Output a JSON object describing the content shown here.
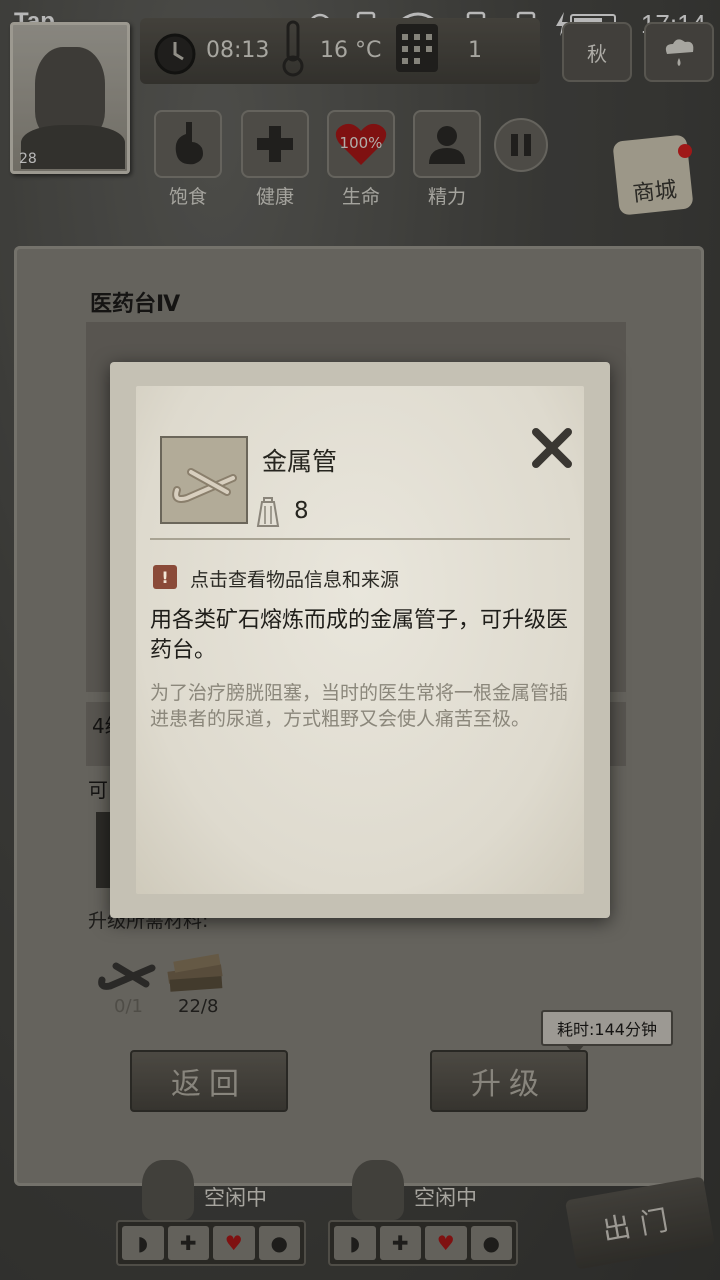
{
  "status_bar": {
    "brand": "Tap",
    "time": "17:14",
    "icons": [
      "alarm-icon",
      "sim-icon",
      "wifi-icon",
      "sim-alert-icon",
      "sim-alert-icon",
      "charging-icon",
      "battery-icon"
    ]
  },
  "hud": {
    "level": "28",
    "clock": "08:13",
    "temperature": "16 °C",
    "day": "1",
    "season": "秋",
    "stats": [
      {
        "label": "饱食",
        "icon": "stomach-icon"
      },
      {
        "label": "健康",
        "icon": "cross-icon"
      },
      {
        "label": "生命",
        "icon": "heart-icon",
        "value": "100%"
      },
      {
        "label": "精力",
        "icon": "person-icon"
      }
    ],
    "pause_icon": "pause-icon",
    "shop_label": "商城"
  },
  "panel": {
    "title": "医药台Ⅳ",
    "row_fragment": "4级",
    "row_fragment_right": "可",
    "materials_label": "升级所需材料:",
    "materials": [
      {
        "icon": "metal-pipe-icon",
        "count": "0/1"
      },
      {
        "icon": "wood-planks-icon",
        "count": "22/8"
      }
    ],
    "back_label": "返回",
    "upgrade_label": "升级",
    "time_cost": "耗时:144分钟"
  },
  "characters": [
    {
      "status": "空闲中"
    },
    {
      "status": "空闲中"
    }
  ],
  "exit_label": "出门",
  "modal": {
    "item_name": "金属管",
    "weight": "8",
    "info_hint": "点击查看物品信息和来源",
    "description": "用各类矿石熔炼而成的金属管子，可升级医药台。",
    "lore": "为了治疗膀胱阻塞，当时的医生常将一根金属管插进患者的尿道，方式粗野又会使人痛苦至极。"
  },
  "colors": {
    "modal_paper": "#e9e6dc",
    "info_badge": "#8a4a38",
    "heart": "#b01818",
    "shop_dot": "#dd2222"
  }
}
